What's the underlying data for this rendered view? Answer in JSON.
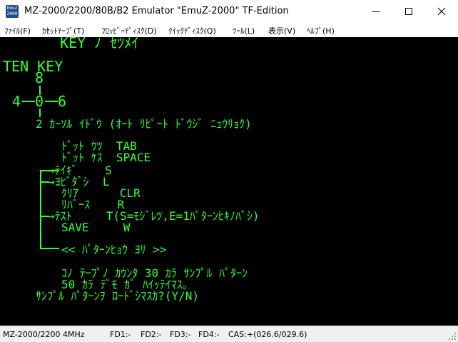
{
  "window": {
    "icon_text_line1": "EmuZ",
    "icon_text_line2": "2000",
    "title": "MZ-2000/2200/80B/B2 Emulator \"EmuZ-2000\" TF-Edition"
  },
  "menu": [
    {
      "label": "ﾌｧｲﾙ(F)"
    },
    {
      "label": "ｶｾｯﾄﾃｰﾌﾟ(T)"
    },
    {
      "label": "ﾌﾛｯﾋﾟｰﾃﾞｨｽｸ(D)"
    },
    {
      "label": "ｸｲｯｸﾃﾞｨｽｸ(Q)"
    },
    {
      "label": "ﾂｰﾙ(L)"
    },
    {
      "label": "表示(V)"
    },
    {
      "label": "ﾍﾙﾌﾟ(H)"
    }
  ],
  "screen": {
    "lines": [
      "  KEY ﾉ ｾﾂﾒｲ",
      "TEN KEY",
      "8",
      "4",
      "0",
      "6",
      "2 ｶｰｿﾙ ｲﾄﾞｳ (ｵｰﾄ ﾘﾋﾟｰﾄ ﾄﾞｳｼﾞ ﾆｭｳﾘｮｸ)",
      "ﾄﾞｯﾄ ｳﾂ  TAB",
      "ﾄﾞｯﾄ ｹｽ  SPACE",
      "→ﾃｲｷﾞ    S",
      "→ﾖﾋﾞﾀﾞｼ  L",
      "ｸﾘｱ      CLR",
      "ﾘﾊﾞｰｽ    R",
      "→ﾃｽﾄ     T(S=ﾓｼﾞﾚﾂ,E=1ﾊﾟﾀｰﾝﾋｷﾉﾊﾞｼ)",
      "SAVE     W",
      "<< ﾊﾟﾀｰﾝﾋｮｳ ﾖﾘ >>",
      "ｺﾉ ﾃｰﾌﾟﾉ ｶｳﾝﾀ 30 ｶﾗ ｻﾝﾌﾟﾙ ﾊﾟﾀｰﾝ",
      "50 ｶﾗ ﾃﾞﾓ ｶﾞ ﾊｲｯﾃｲﾏｽ｡",
      "ｻﾝﾌﾟﾙ ﾊﾟﾀｰﾝｦ ﾛｰﾄﾞｼﾏｽｶ?(Y/N)"
    ]
  },
  "status": {
    "machine": "MZ-2000/2200 4MHz",
    "fd1": "FD1:-",
    "fd2": "FD2:-",
    "fd3": "FD3:-",
    "fd4": "FD4:-",
    "cas": "CAS:+(026.6/029.6)"
  },
  "colors": {
    "crt_green": "#33ff33",
    "screen_bg": "#000000",
    "chrome_bg": "#ffffff",
    "status_bg": "#f0f0f0"
  }
}
